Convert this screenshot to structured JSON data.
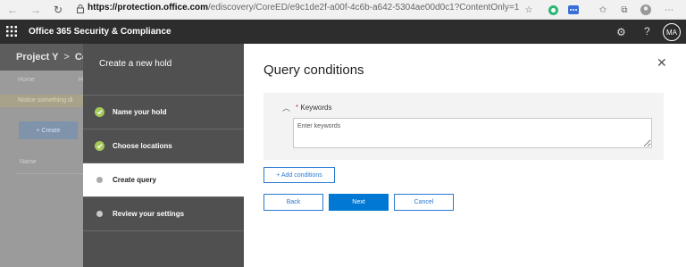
{
  "browser": {
    "url_host": "https://protection.office.com",
    "url_path": "/ediscovery/CoreED/e9c1de2f-a00f-4c6b-a642-5304ae00d0c1?ContentOnly=1"
  },
  "suite": {
    "title": "Office 365 Security & Compliance",
    "user_initials": "MA"
  },
  "background": {
    "project": "Project Y",
    "project_sep": ">",
    "project_next": "Co",
    "home_tab": "Home",
    "h_tab": "H",
    "notice": "Notice something di",
    "create_button": "+ Create",
    "name_column": "Name"
  },
  "wizard": {
    "heading": "Create a new hold",
    "steps": [
      {
        "label": "Name your hold",
        "state": "done"
      },
      {
        "label": "Choose locations",
        "state": "done"
      },
      {
        "label": "Create query",
        "state": "current"
      },
      {
        "label": "Review your settings",
        "state": "pending"
      }
    ]
  },
  "panel": {
    "title": "Query conditions",
    "keywords": {
      "required_mark": "*",
      "label": "Keywords",
      "placeholder": "Enter keywords"
    },
    "add_conditions": "+ Add conditions",
    "buttons": {
      "back": "Back",
      "next": "Next",
      "cancel": "Cancel"
    }
  },
  "colors": {
    "accent": "#0078d4",
    "check": "#a5c85a",
    "required": "#d13438"
  }
}
